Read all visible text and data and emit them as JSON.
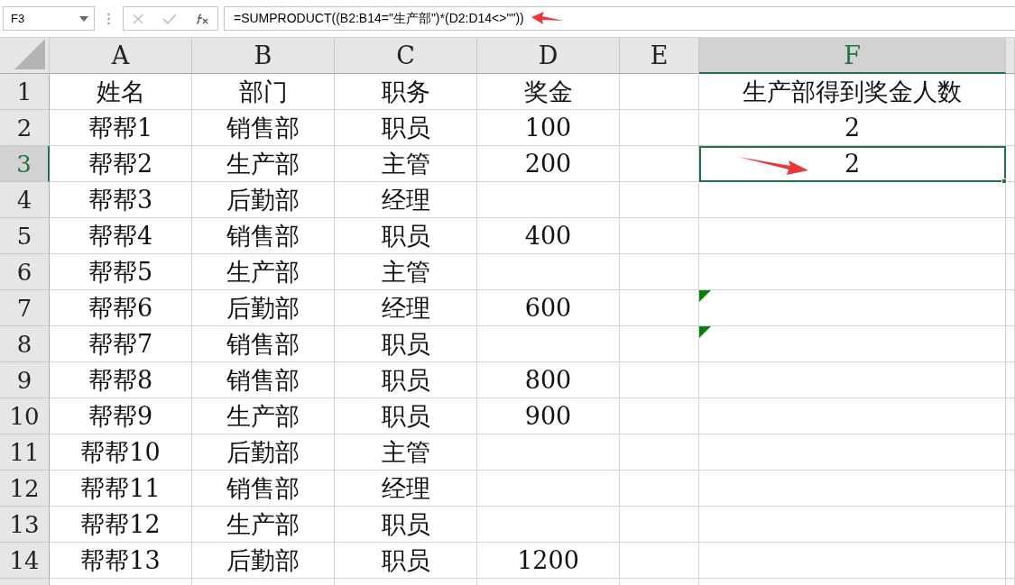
{
  "name_box": "F3",
  "formula": "=SUMPRODUCT((B2:B14=\"生产部\")*(D2:D14<>\"\"))",
  "columns": [
    {
      "label": "A",
      "selected": false
    },
    {
      "label": "B",
      "selected": false
    },
    {
      "label": "C",
      "selected": false
    },
    {
      "label": "D",
      "selected": false
    },
    {
      "label": "E",
      "selected": false
    },
    {
      "label": "F",
      "selected": true
    }
  ],
  "rows": [
    {
      "label": "1",
      "selected": false,
      "flag": false,
      "cells": {
        "A": "姓名",
        "B": "部门",
        "C": "职务",
        "D": "奖金",
        "F": "生产部得到奖金人数"
      }
    },
    {
      "label": "2",
      "selected": false,
      "flag": false,
      "cells": {
        "A": "帮帮1",
        "B": "销售部",
        "C": "职员",
        "D": "100",
        "F": "2"
      }
    },
    {
      "label": "3",
      "selected": true,
      "flag": false,
      "cells": {
        "A": "帮帮2",
        "B": "生产部",
        "C": "主管",
        "D": "200",
        "F": "2"
      }
    },
    {
      "label": "4",
      "selected": false,
      "flag": false,
      "cells": {
        "A": "帮帮3",
        "B": "后勤部",
        "C": "经理"
      }
    },
    {
      "label": "5",
      "selected": false,
      "flag": false,
      "cells": {
        "A": "帮帮4",
        "B": "销售部",
        "C": "职员",
        "D": "400"
      }
    },
    {
      "label": "6",
      "selected": false,
      "flag": false,
      "cells": {
        "A": "帮帮5",
        "B": "生产部",
        "C": "主管"
      }
    },
    {
      "label": "7",
      "selected": false,
      "flag": true,
      "cells": {
        "A": "帮帮6",
        "B": "后勤部",
        "C": "经理",
        "D": "600"
      }
    },
    {
      "label": "8",
      "selected": false,
      "flag": true,
      "cells": {
        "A": "帮帮7",
        "B": "销售部",
        "C": "职员"
      }
    },
    {
      "label": "9",
      "selected": false,
      "flag": false,
      "cells": {
        "A": "帮帮8",
        "B": "销售部",
        "C": "职员",
        "D": "800"
      }
    },
    {
      "label": "10",
      "selected": false,
      "flag": false,
      "cells": {
        "A": "帮帮9",
        "B": "生产部",
        "C": "职员",
        "D": "900"
      }
    },
    {
      "label": "11",
      "selected": false,
      "flag": false,
      "cells": {
        "A": "帮帮10",
        "B": "后勤部",
        "C": "主管"
      }
    },
    {
      "label": "12",
      "selected": false,
      "flag": false,
      "cells": {
        "A": "帮帮11",
        "B": "销售部",
        "C": "经理"
      }
    },
    {
      "label": "13",
      "selected": false,
      "flag": false,
      "cells": {
        "A": "帮帮12",
        "B": "生产部",
        "C": "职员"
      }
    },
    {
      "label": "14",
      "selected": false,
      "flag": false,
      "cells": {
        "A": "帮帮13",
        "B": "后勤部",
        "C": "职员",
        "D": "1200"
      }
    }
  ]
}
